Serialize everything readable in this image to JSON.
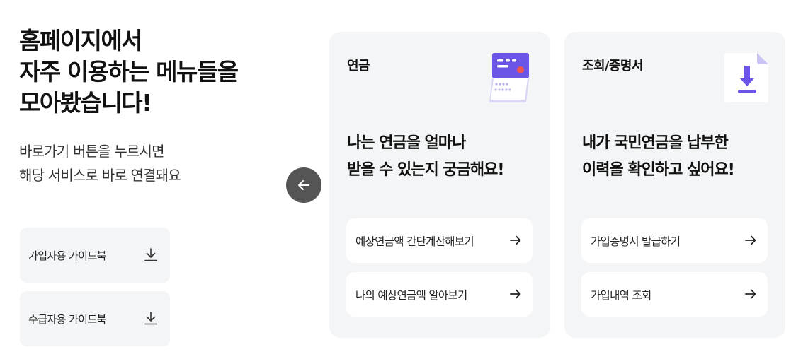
{
  "intro": {
    "headline": [
      "홈페이지에서",
      "자주 이용하는 메뉴들을",
      "모아봤습니다!"
    ],
    "subtitle": [
      "바로가기 버튼을 누르시면",
      "해당 서비스로 바로 연결돼요"
    ]
  },
  "guides": [
    {
      "label": "가입자용 가이드북",
      "icon": "download-icon"
    },
    {
      "label": "수급자용 가이드북",
      "icon": "download-icon"
    }
  ],
  "nav": {
    "back_icon": "arrow-left-icon"
  },
  "cards": [
    {
      "title": "연금",
      "icon": "pension-card-icon",
      "description": [
        "나는 연금을 얼마나",
        "받을 수 있는지 궁금해요!"
      ],
      "links": [
        {
          "label": "예상연금액 간단계산해보기",
          "icon": "arrow-right-icon"
        },
        {
          "label": "나의 예상연금액 알아보기",
          "icon": "arrow-right-icon"
        }
      ]
    },
    {
      "title": "조회/증명서",
      "icon": "document-download-icon",
      "description": [
        "내가 국민연금을 납부한",
        "이력을 확인하고 싶어요!"
      ],
      "links": [
        {
          "label": "가입증명서 발급하기",
          "icon": "arrow-right-icon"
        },
        {
          "label": "가입내역 조회",
          "icon": "arrow-right-icon"
        }
      ]
    }
  ],
  "colors": {
    "card_bg": "#f4f5f7",
    "accent_purple": "#6b55e6",
    "icon_red": "#f0564a",
    "back_button": "#555555"
  }
}
